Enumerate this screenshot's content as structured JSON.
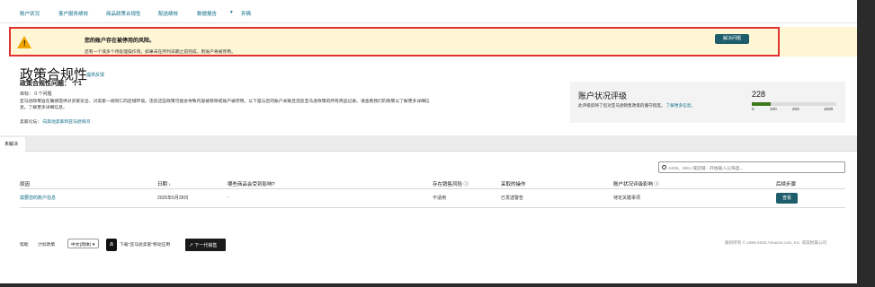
{
  "nav": {
    "items": [
      "账户状况",
      "客户服务绩效",
      "商品政策合规性",
      "配送绩效",
      "数据报告",
      "弃辆"
    ],
    "data_report_suffix": "▾"
  },
  "alert": {
    "title": "您的账户存在被停用的风险。",
    "desc": "您有一个或多个待处理操作项。如果未在所列日期之前完成，则账户将被停用。",
    "button": "解决问题"
  },
  "policy": {
    "title": "政策合规性",
    "title_link": "提供反馈",
    "issues": "政策合规性问题：  个1",
    "goal": "目标：  0 个问题",
    "description": "亚马逊政策旨在确保提供对买家安全、对卖家一视同仁的店铺环境。违反这些政策可能会导致内容被移除或账户被停用。以下是与您的账户关联且违反亚马逊政策的所有商品记录。请查看我们的政策以了解更多详细信息。了解更多详细信息。",
    "forum_label": "卖家论坛：",
    "forum_link": "向其他卖家和亚马逊询问"
  },
  "health": {
    "title": "账户状况评级",
    "desc": "此评级反映了您对亚马逊销售政策的遵守程度。",
    "learn_more": "了解更多信息。",
    "score": "228",
    "score_fraction": 0.228,
    "ticks": [
      "0",
      "100",
      "200",
      "1000"
    ]
  },
  "tabs": {
    "active": "未解决"
  },
  "search": {
    "placeholder": "ASIN、SKU 或店铺 - 开始输入以筛选..."
  },
  "table": {
    "headers": [
      "原因",
      "日期 ↓",
      "哪些商品会受到影响?",
      "存在销售风险 ⓘ",
      "采取的操作",
      "账户状况评级影响 ⓘ",
      "后续步骤"
    ],
    "row": {
      "reason": "需要您的账户信息",
      "date": "2025年6月28日",
      "affected": "-",
      "sales_risk": "不适用",
      "action": "已发送警告",
      "impact": "待定关键事项",
      "next_step": "查看"
    }
  },
  "footer": {
    "help": "帮助",
    "program_policy": "计划政策",
    "language": "中文(简体)",
    "language_caret": "▾",
    "app_text": "下载\"亚马逊卖家\"移动应用",
    "next_button": "下一代销售",
    "copyright": "版权所有 © 1999-2025 Amazon.com, Inc. 或其附属公司"
  }
}
